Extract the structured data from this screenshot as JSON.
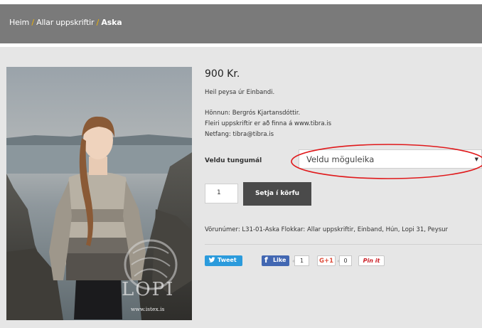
{
  "breadcrumb": {
    "home": "Heim",
    "sep1": "/",
    "category": "Allar uppskriftir",
    "sep2": "/",
    "current": "Aska"
  },
  "product": {
    "price": "900 Kr.",
    "description": "Heil peysa úr Einbandi.",
    "designer": "Hönnun: Bergrós Kjartansdóttir.",
    "more": "Fleiri uppskriftir er að finna á www.tibra.is",
    "email": "Netfang: tibra@tibra.is",
    "image_logo_text": "LOPI",
    "image_url_text": "www.istex.is"
  },
  "options": {
    "language_label": "Veldu tungumál",
    "select_value": "Veldu möguleika"
  },
  "cart": {
    "quantity": "1",
    "add_label": "Setja í körfu"
  },
  "meta": {
    "text": "Vörunúmer: L31-01-Aska Flokkar: Allar uppskriftir, Einband, Hún, Lopi 31, Peysur"
  },
  "social": {
    "tweet": "Tweet",
    "like": "Like",
    "like_count": "1",
    "gplus": "G+1",
    "gplus_count": "0",
    "pin": "Pin it"
  },
  "colors": {
    "breadcrumb_bar": "#7a7a7a",
    "breadcrumb_separator": "#f0b400",
    "button_dark": "#4a4a4a",
    "highlight_ellipse": "#e0191b",
    "twitter": "#2b9bdc",
    "facebook": "#4267b2"
  }
}
